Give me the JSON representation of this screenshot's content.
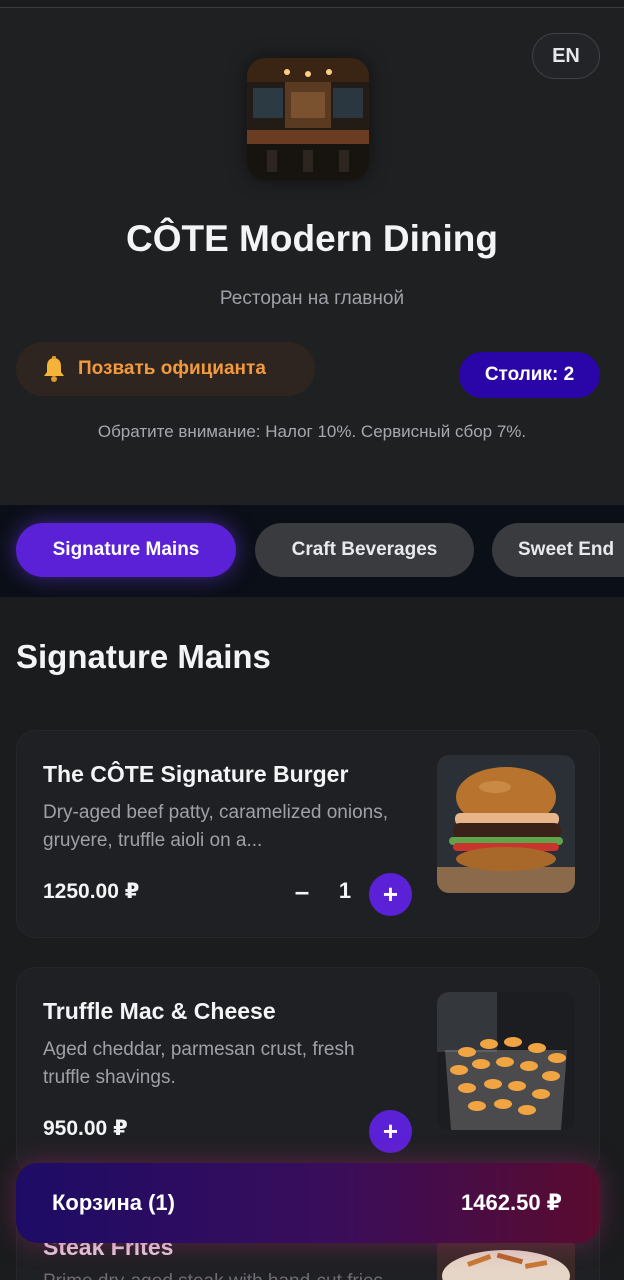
{
  "header": {
    "language_button": "EN",
    "restaurant_name": "CÔTE Modern Dining",
    "subtitle": "Ресторан на главной",
    "call_waiter_label": "Позвать официанта",
    "bell_icon": "bell-icon",
    "table_badge": "Столик: 2",
    "notice": "Обратите внимание: Налог 10%. Сервисный сбор 7%."
  },
  "tabs": [
    {
      "label": "Signature Mains",
      "active": true
    },
    {
      "label": "Craft Beverages",
      "active": false
    },
    {
      "label": "Sweet End",
      "active": false
    }
  ],
  "section": {
    "title": "Signature Mains"
  },
  "items": [
    {
      "name": "The CÔTE Signature Burger",
      "description": "Dry-aged beef patty, caramelized onions, gruyere, truffle aioli on a...",
      "price": "1250.00 ₽",
      "quantity": "1",
      "minus_label": "–",
      "plus_label": "+"
    },
    {
      "name": "Truffle Mac & Cheese",
      "description": "Aged cheddar, parmesan crust, fresh truffle shavings.",
      "price": "950.00 ₽",
      "plus_label": "+"
    },
    {
      "name": "Steak Frites",
      "description": "Prime dry-aged steak with hand-cut fries."
    }
  ],
  "cart": {
    "label": "Корзина (1)",
    "total": "1462.50 ₽"
  },
  "colors": {
    "accent": "#5b21d6",
    "table_badge": "#2a06a8",
    "waiter_text": "#f29a3c",
    "background": "#1b1c1e"
  }
}
